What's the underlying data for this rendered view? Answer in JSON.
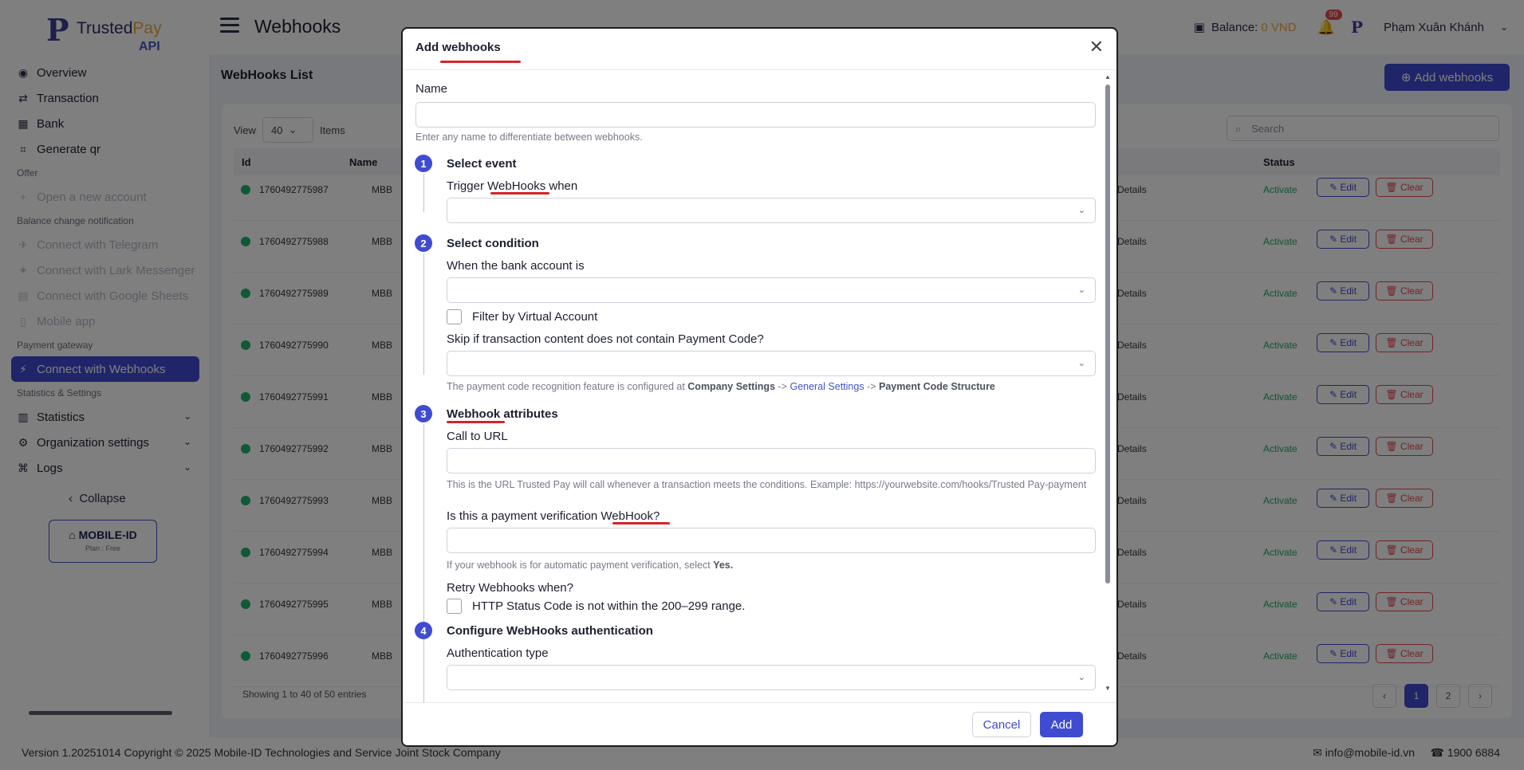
{
  "app": {
    "logo_text_a": "Trusted",
    "logo_text_b": "Pay",
    "logo_sub": "API",
    "page_title": "Webhooks",
    "balance_label": "Balance:",
    "balance_value": "0 VND",
    "notif_count": "99",
    "user_name": "Phạm Xuân Khánh",
    "accent_color": "#3f4bd1"
  },
  "sidebar": {
    "items": [
      {
        "type": "item",
        "label": "Overview",
        "icon": "eye-icon",
        "glyph": "◉"
      },
      {
        "type": "item",
        "label": "Transaction",
        "icon": "transaction-icon",
        "glyph": "⇄"
      },
      {
        "type": "item",
        "label": "Bank",
        "icon": "bank-icon",
        "glyph": "▦"
      },
      {
        "type": "item",
        "label": "Generate qr",
        "icon": "qr-icon",
        "glyph": "⌗"
      },
      {
        "type": "group",
        "label": "Offer"
      },
      {
        "type": "item",
        "label": "Open a new account",
        "icon": "account-icon",
        "glyph": "+",
        "disabled": true
      },
      {
        "type": "group",
        "label": "Balance change notification"
      },
      {
        "type": "item",
        "label": "Connect with Telegram",
        "icon": "telegram-icon",
        "glyph": "✈",
        "disabled": true
      },
      {
        "type": "item",
        "label": "Connect with Lark Messenger",
        "icon": "lark-icon",
        "glyph": "✦",
        "disabled": true
      },
      {
        "type": "item",
        "label": "Connect with Google Sheets",
        "icon": "sheets-icon",
        "glyph": "▤",
        "disabled": true
      },
      {
        "type": "item",
        "label": "Mobile app",
        "icon": "mobile-icon",
        "glyph": "▯",
        "disabled": true
      },
      {
        "type": "group",
        "label": "Payment gateway"
      },
      {
        "type": "item",
        "label": "Connect with Webhooks",
        "icon": "webhook-icon",
        "glyph": "⚡",
        "active": true
      },
      {
        "type": "group",
        "label": "Statistics & Settings"
      },
      {
        "type": "item",
        "label": "Statistics",
        "icon": "chart-icon",
        "glyph": "▥",
        "chev": true
      },
      {
        "type": "item",
        "label": "Organization settings",
        "icon": "gear-icon",
        "glyph": "⚙",
        "chev": true
      },
      {
        "type": "item",
        "label": "Logs",
        "icon": "logs-icon",
        "glyph": "⌘",
        "chev": true
      }
    ],
    "collapse_label": "Collapse",
    "org_name": "MOBILE-ID",
    "org_plan": "Plan : Free"
  },
  "list": {
    "title": "WebHooks List",
    "add_label": "Add webhooks",
    "view_label": "View",
    "view_value": "40",
    "items_label": "Items",
    "search_placeholder": "Search",
    "col_id": "Id",
    "col_name": "Name",
    "col_status": "Status",
    "ids": [
      "1760492775987",
      "1760492775988",
      "1760492775989",
      "1760492775990",
      "1760492775991",
      "1760492775992",
      "1760492775993",
      "1760492775994",
      "1760492775995",
      "1760492775996"
    ],
    "name_value": "MBB",
    "event_value": "ntDetails",
    "status_value": "Activate",
    "edit_label": "Edit",
    "clear_label": "Clear",
    "showing": "Showing 1 to 40 of 50 entries",
    "pages": [
      "1",
      "2"
    ]
  },
  "footer": {
    "version": "Version 1.20251014 Copyright © 2025 Mobile-ID Technologies and Service Joint Stock Company",
    "email": "info@mobile-id.vn",
    "phone": "1900 6884"
  },
  "modal": {
    "title": "Add webhooks",
    "name_label": "Name",
    "name_value": "",
    "name_help": "Enter any name to differentiate between webhooks.",
    "step1_num": "1",
    "step1_title": "Select event",
    "trigger_label": "Trigger WebHooks when",
    "step2_num": "2",
    "step2_title": "Select condition",
    "bank_label": "When the bank account is",
    "virtual_label": "Filter by Virtual Account",
    "skip_label": "Skip if transaction content does not contain Payment Code?",
    "payment_help_pre": "The payment code recognition feature is configured at",
    "payment_help_company": "Company Settings",
    "payment_help_arrow": "->",
    "payment_help_general": "General Settings",
    "payment_help_structure": "Payment Code Structure",
    "step3_num": "3",
    "step3_title": "Webhook attributes",
    "url_label": "Call to URL",
    "url_help": "This is the URL Trusted Pay will call whenever a transaction meets the conditions. Example: https://yourwebsite.com/hooks/Trusted Pay-payment",
    "verify_label": "Is this a payment verification WebHook?",
    "verify_help_pre": "If your webhook is for automatic payment verification, select",
    "verify_help_yes": "Yes.",
    "retry_label": "Retry Webhooks when?",
    "retry_option": "HTTP Status Code is not within the 200–299 range.",
    "step4_num": "4",
    "step4_title": "Configure WebHooks authentication",
    "auth_label": "Authentication type",
    "cancel_label": "Cancel",
    "add_label": "Add"
  }
}
